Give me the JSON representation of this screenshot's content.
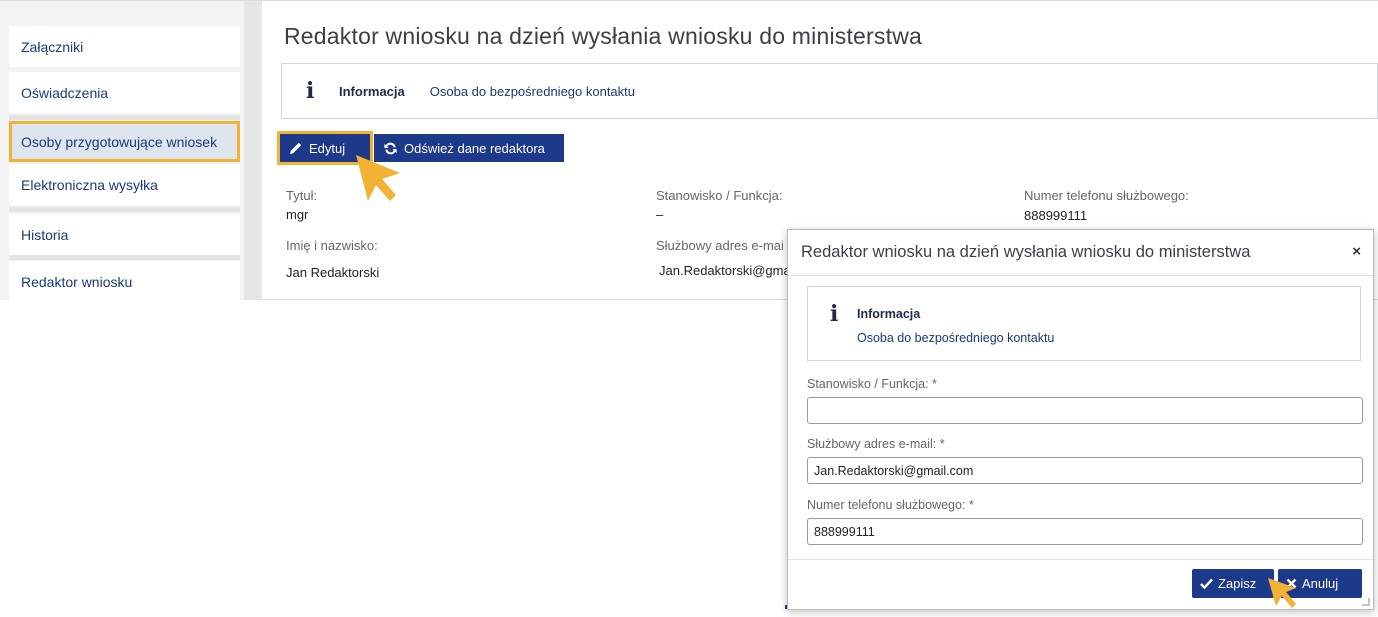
{
  "sidebar": {
    "items": [
      {
        "label": "Załączniki"
      },
      {
        "label": "Oświadczenia"
      },
      {
        "label": "Osoby przygotowujące wniosek"
      },
      {
        "label": "Elektroniczna wysyłka"
      },
      {
        "label": "Historia"
      },
      {
        "label": "Redaktor wniosku"
      }
    ]
  },
  "main": {
    "title": "Redaktor wniosku na dzień wysłania wniosku do ministerstwa",
    "info": {
      "label": "Informacja",
      "text": "Osoba do bezpośredniego kontaktu"
    },
    "buttons": {
      "edit": "Edytuj",
      "refresh": "Odśwież dane redaktora"
    },
    "fields": {
      "title_label": "Tytuł:",
      "title_value": "mgr",
      "position_label": "Stanowisko / Funkcja:",
      "position_value": "–",
      "phone_label": "Numer telefonu służbowego:",
      "phone_value": "888999111",
      "name_label": "Imię i nazwisko:",
      "name_value": "Jan Redaktorski",
      "email_label": "Służbowy adres e-mai",
      "email_value": "Jan.Redaktorski@gma"
    }
  },
  "modal": {
    "title": "Redaktor wniosku na dzień wysłania wniosku do ministerstwa",
    "close": "×",
    "info": {
      "label": "Informacja",
      "text": "Osoba do bezpośredniego kontaktu"
    },
    "position_label": "Stanowisko / Funkcja: *",
    "position_value": "",
    "email_label": "Służbowy adres e-mail: *",
    "email_value": "Jan.Redaktorski@gmail.com",
    "phone_label": "Numer telefonu służbowego: *",
    "phone_value": "888999111",
    "save": "Zapisz",
    "cancel": "Anuluj"
  },
  "colors": {
    "primary": "#1d3a8a",
    "highlight": "#f2b233",
    "link": "#1a3a78"
  },
  "icons": {
    "info": "info-icon",
    "edit": "pencil-icon",
    "refresh": "refresh-icon",
    "close": "close-icon",
    "save": "checkmark-icon",
    "cancel": "x-icon",
    "pointer": "arrow-cursor-icon"
  }
}
